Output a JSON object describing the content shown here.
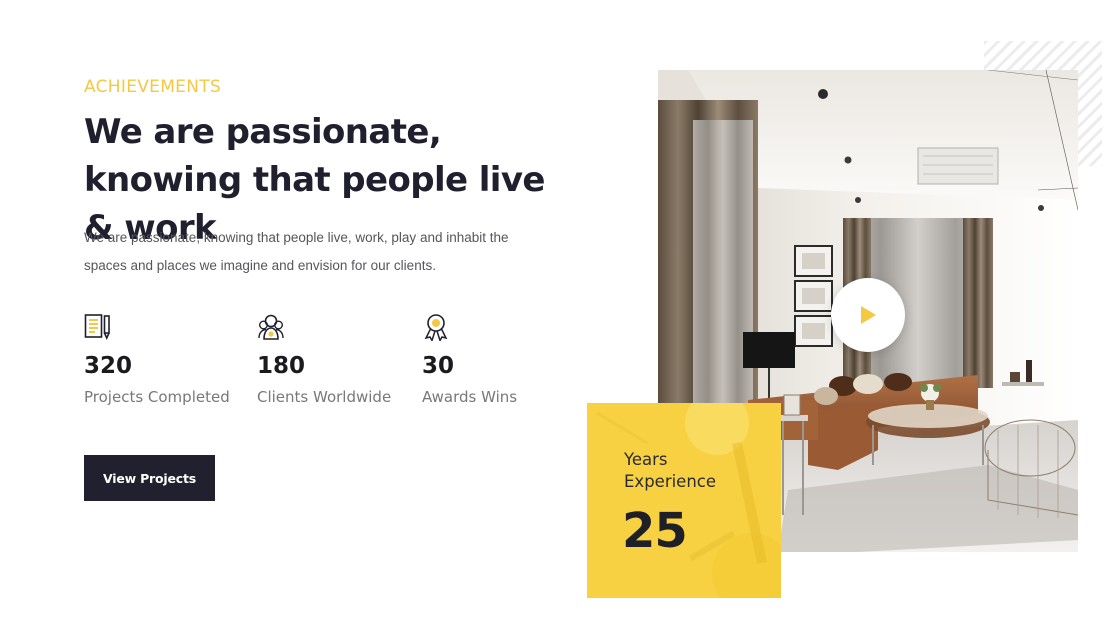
{
  "section": {
    "eyebrow": "ACHIEVEMENTS",
    "headline": "We are passionate, knowing that people live & work",
    "intro": "We are passionate, knowing that people live, work, play and inhabit the spaces and places we imagine and envision for our clients."
  },
  "stats": [
    {
      "icon": "blueprint-pencil-icon",
      "value": "320",
      "label": "Projects Completed"
    },
    {
      "icon": "clients-group-icon",
      "value": "180",
      "label": "Clients Worldwide"
    },
    {
      "icon": "award-medal-icon",
      "value": "30",
      "label": "Awards Wins"
    }
  ],
  "cta": {
    "label": "View Projects"
  },
  "experience": {
    "label": "Years Experience",
    "value": "25"
  },
  "media": {
    "play_icon": "play-icon"
  },
  "colors": {
    "accent": "#f5c842",
    "dark": "#20202e",
    "text_muted": "#77787d"
  }
}
